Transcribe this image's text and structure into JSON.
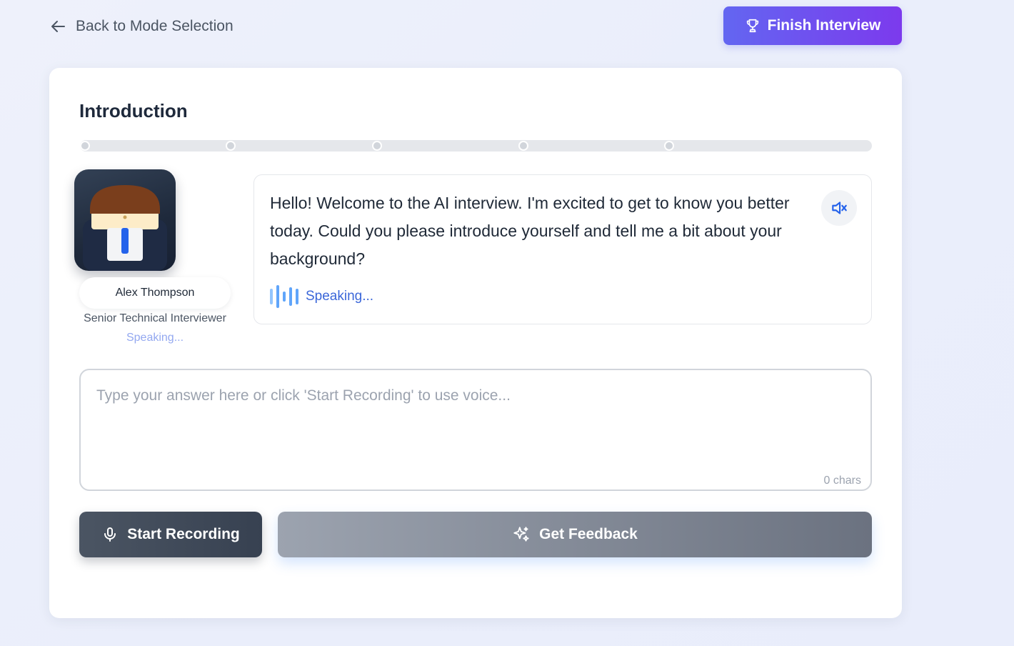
{
  "nav": {
    "back_label": "Back to Mode Selection",
    "back_icon": "arrow-left-icon",
    "finish_label": "Finish Interview",
    "finish_icon": "trophy-icon",
    "finish_color_start": "#6366f1",
    "finish_color_end": "#7c3aed"
  },
  "section": {
    "title": "Introduction",
    "steps_total": 5,
    "current_step": 1
  },
  "interviewer": {
    "name": "Alex Thompson",
    "role": "Senior Technical Interviewer",
    "status": "Speaking..."
  },
  "message": {
    "text": "Hello! Welcome to the AI interview. I'm excited to get to know you better today. Could you please introduce yourself and tell me a bit about your background?",
    "speaking_label": "Speaking...",
    "mute_icon": "volume-mute-icon",
    "accent": "#3b67d9"
  },
  "answer": {
    "placeholder": "Type your answer here or click 'Start Recording' to use voice...",
    "value": "",
    "char_count": "0 chars"
  },
  "actions": {
    "record_label": "Start Recording",
    "record_icon": "microphone-icon",
    "feedback_label": "Get Feedback",
    "feedback_icon": "sparkles-icon"
  }
}
